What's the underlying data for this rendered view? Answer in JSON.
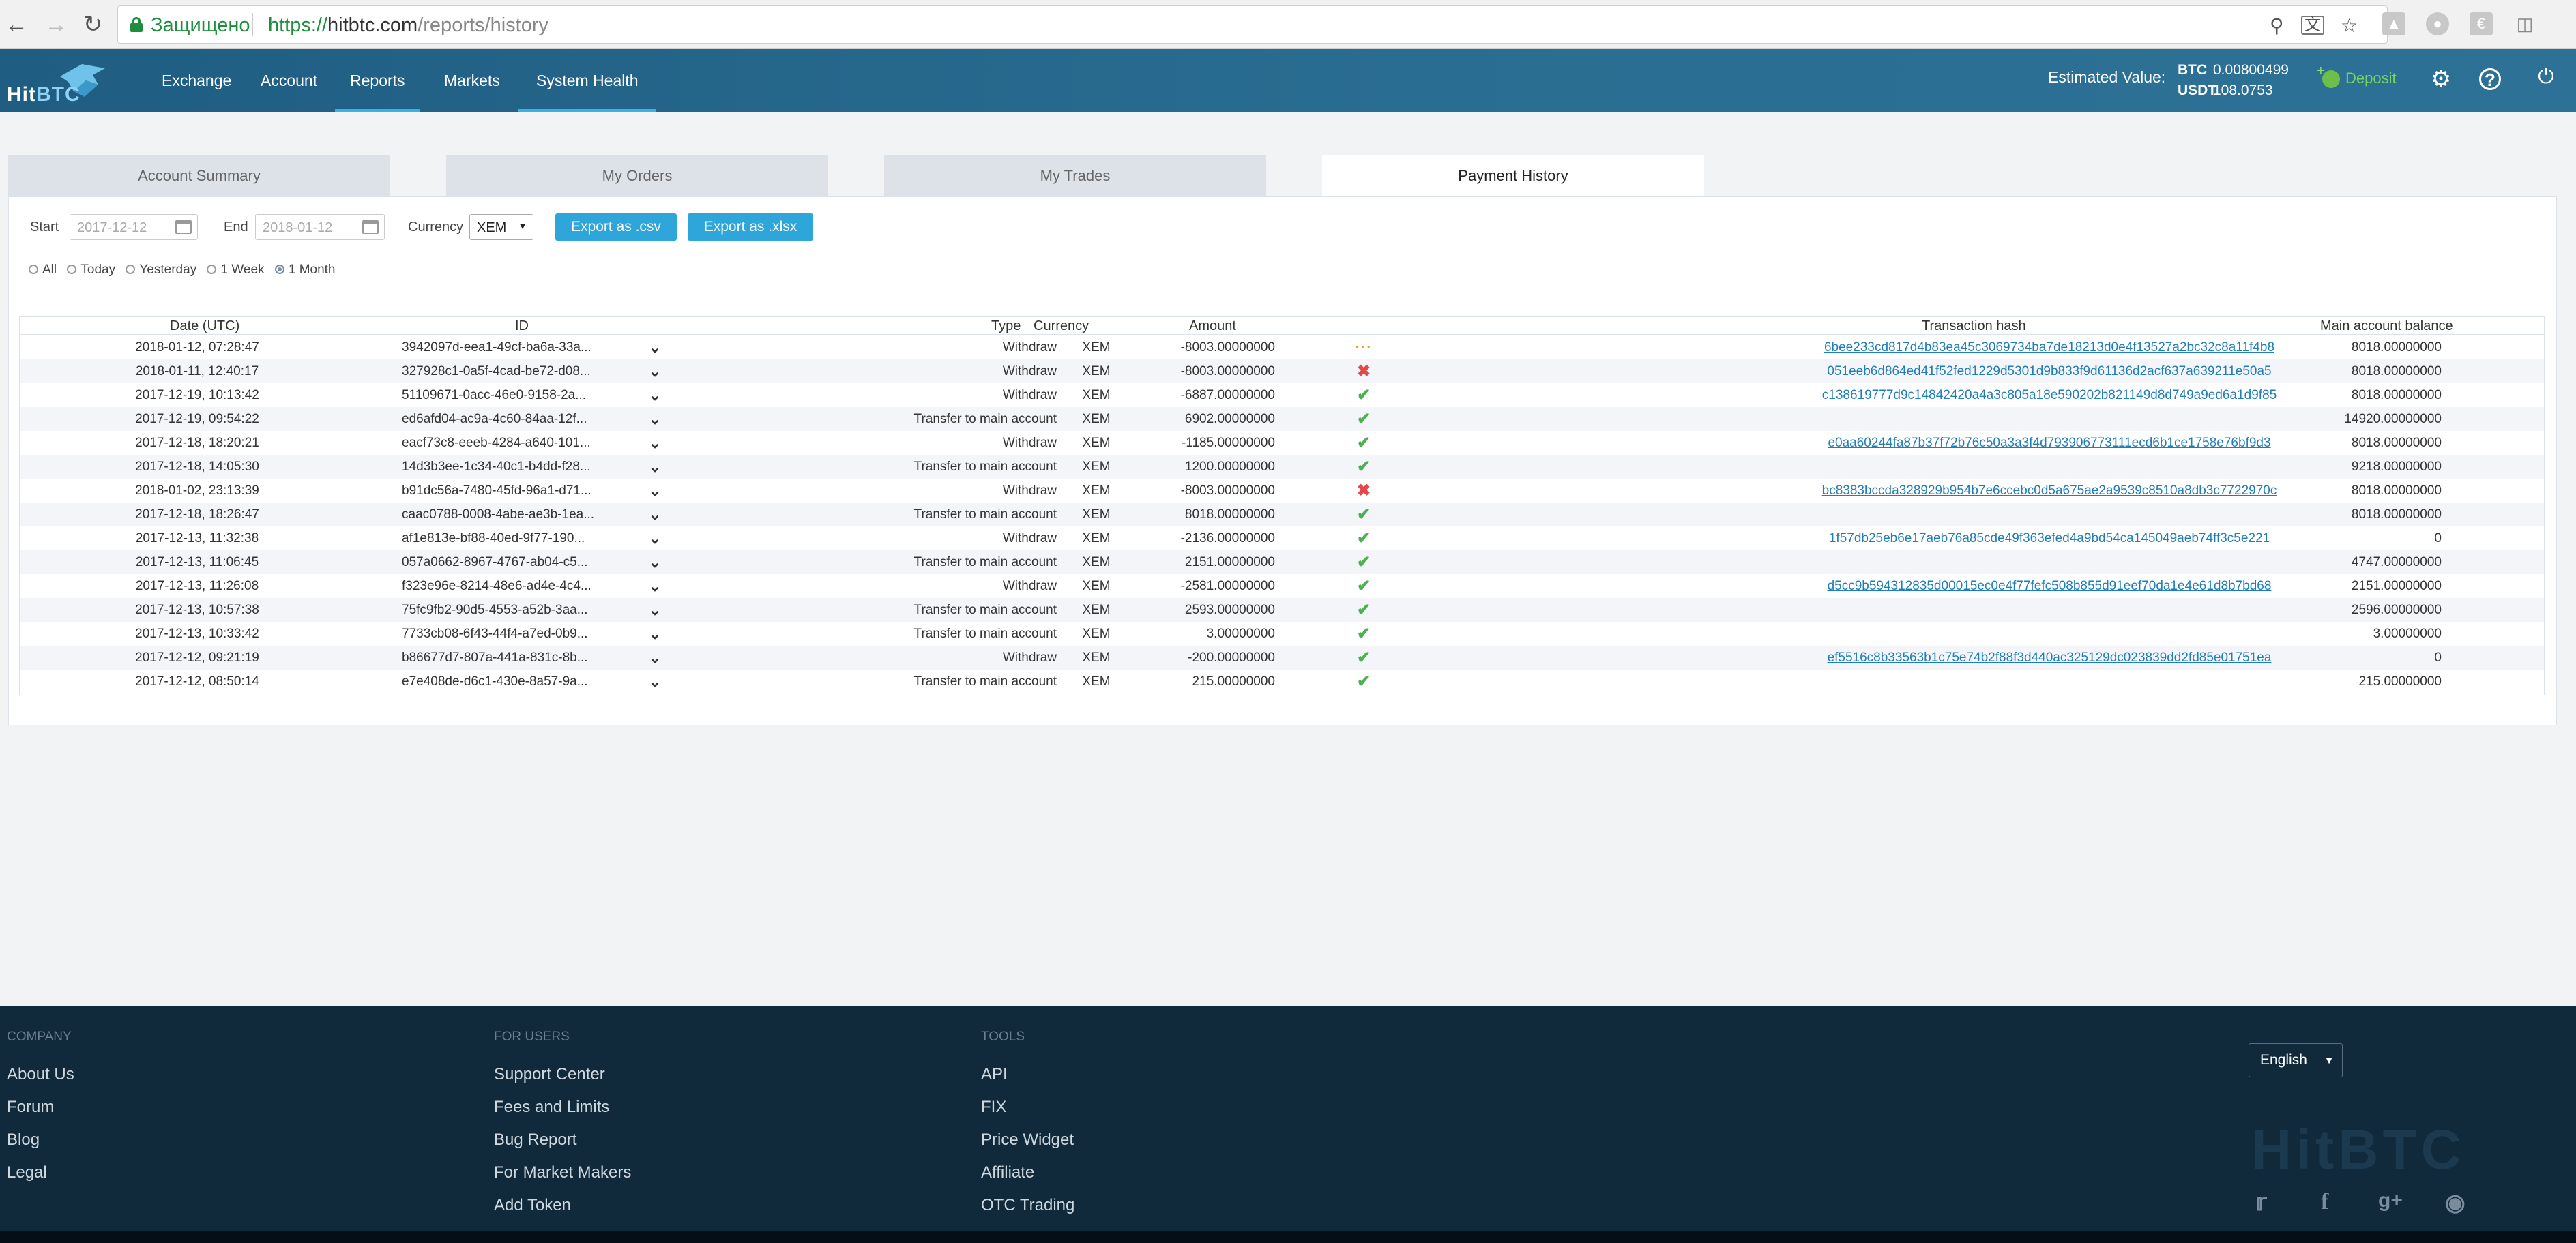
{
  "browser": {
    "secure_label": "Защищено",
    "url_scheme": "https://",
    "url_host": "hitbtc.com",
    "url_path": "/reports/history"
  },
  "header": {
    "logo_hit": "Hit",
    "logo_btc": "BTC",
    "nav": [
      "Exchange",
      "Account",
      "Reports",
      "Markets",
      "System Health"
    ],
    "estimated_label": "Estimated Value:",
    "est_btc_label": "BTC",
    "est_btc_value": "0.00800499",
    "est_usdt_label": "USDT",
    "est_usdt_value": "108.0753",
    "deposit_label": "Deposit"
  },
  "tabs": [
    "Account Summary",
    "My Orders",
    "My Trades",
    "Payment History"
  ],
  "filters": {
    "start_label": "Start",
    "start_value": "2017-12-12",
    "end_label": "End",
    "end_value": "2018-01-12",
    "currency_label": "Currency",
    "currency_value": "XEM",
    "export_csv": "Export as .csv",
    "export_xlsx": "Export as .xlsx",
    "ranges": [
      "All",
      "Today",
      "Yesterday",
      "1 Week",
      "1 Month"
    ],
    "selected_range": "1 Month"
  },
  "table": {
    "headers": [
      "Date (UTC)",
      "ID",
      "Type",
      "Currency",
      "Amount",
      "Transaction hash",
      "Main account balance"
    ],
    "rows": [
      {
        "date": "2018-01-12, 07:28:47",
        "id": "3942097d-eea1-49cf-ba6a-33a...",
        "type": "Withdraw",
        "currency": "XEM",
        "amount": "-8003.00000000",
        "status": "pending",
        "hash": "6bee233cd817d4b83ea45c3069734ba7de18213d0e4f13527a2bc32c8a11f4b8",
        "balance": "8018.00000000"
      },
      {
        "date": "2018-01-11, 12:40:17",
        "id": "327928c1-0a5f-4cad-be72-d08...",
        "type": "Withdraw",
        "currency": "XEM",
        "amount": "-8003.00000000",
        "status": "failed",
        "hash": "051eeb6d864ed41f52fed1229d5301d9b833f9d61136d2acf637a639211e50a5",
        "balance": "8018.00000000"
      },
      {
        "date": "2017-12-19, 10:13:42",
        "id": "51109671-0acc-46e0-9158-2a...",
        "type": "Withdraw",
        "currency": "XEM",
        "amount": "-6887.00000000",
        "status": "success",
        "hash": "c138619777d9c14842420a4a3c805a18e590202b821149d8d749a9ed6a1d9f85",
        "balance": "8018.00000000"
      },
      {
        "date": "2017-12-19, 09:54:22",
        "id": "ed6afd04-ac9a-4c60-84aa-12f...",
        "type": "Transfer to main account",
        "currency": "XEM",
        "amount": "6902.00000000",
        "status": "success",
        "hash": "",
        "balance": "14920.00000000"
      },
      {
        "date": "2017-12-18, 18:20:21",
        "id": "eacf73c8-eeeb-4284-a640-101...",
        "type": "Withdraw",
        "currency": "XEM",
        "amount": "-1185.00000000",
        "status": "success",
        "hash": "e0aa60244fa87b37f72b76c50a3a3f4d793906773111ecd6b1ce1758e76bf9d3",
        "balance": "8018.00000000"
      },
      {
        "date": "2017-12-18, 14:05:30",
        "id": "14d3b3ee-1c34-40c1-b4dd-f28...",
        "type": "Transfer to main account",
        "currency": "XEM",
        "amount": "1200.00000000",
        "status": "success",
        "hash": "",
        "balance": "9218.00000000"
      },
      {
        "date": "2018-01-02, 23:13:39",
        "id": "b91dc56a-7480-45fd-96a1-d71...",
        "type": "Withdraw",
        "currency": "XEM",
        "amount": "-8003.00000000",
        "status": "failed",
        "hash": "bc8383bccda328929b954b7e6ccebc0d5a675ae2a9539c8510a8db3c7722970c",
        "balance": "8018.00000000"
      },
      {
        "date": "2017-12-18, 18:26:47",
        "id": "caac0788-0008-4abe-ae3b-1ea...",
        "type": "Transfer to main account",
        "currency": "XEM",
        "amount": "8018.00000000",
        "status": "success",
        "hash": "",
        "balance": "8018.00000000"
      },
      {
        "date": "2017-12-13, 11:32:38",
        "id": "af1e813e-bf88-40ed-9f77-190...",
        "type": "Withdraw",
        "currency": "XEM",
        "amount": "-2136.00000000",
        "status": "success",
        "hash": "1f57db25eb6e17aeb76a85cde49f363efed4a9bd54ca145049aeb74ff3c5e221",
        "balance": "0"
      },
      {
        "date": "2017-12-13, 11:06:45",
        "id": "057a0662-8967-4767-ab04-c5...",
        "type": "Transfer to main account",
        "currency": "XEM",
        "amount": "2151.00000000",
        "status": "success",
        "hash": "",
        "balance": "4747.00000000"
      },
      {
        "date": "2017-12-13, 11:26:08",
        "id": "f323e96e-8214-48e6-ad4e-4c4...",
        "type": "Withdraw",
        "currency": "XEM",
        "amount": "-2581.00000000",
        "status": "success",
        "hash": "d5cc9b594312835d00015ec0e4f77fefc508b855d91eef70da1e4e61d8b7bd68",
        "balance": "2151.00000000"
      },
      {
        "date": "2017-12-13, 10:57:38",
        "id": "75fc9fb2-90d5-4553-a52b-3aa...",
        "type": "Transfer to main account",
        "currency": "XEM",
        "amount": "2593.00000000",
        "status": "success",
        "hash": "",
        "balance": "2596.00000000"
      },
      {
        "date": "2017-12-13, 10:33:42",
        "id": "7733cb08-6f43-44f4-a7ed-0b9...",
        "type": "Transfer to main account",
        "currency": "XEM",
        "amount": "3.00000000",
        "status": "success",
        "hash": "",
        "balance": "3.00000000"
      },
      {
        "date": "2017-12-12, 09:21:19",
        "id": "b86677d7-807a-441a-831c-8b...",
        "type": "Withdraw",
        "currency": "XEM",
        "amount": "-200.00000000",
        "status": "success",
        "hash": "ef5516c8b33563b1c75e74b2f88f3d440ac325129dc023839dd2fd85e01751ea",
        "balance": "0"
      },
      {
        "date": "2017-12-12, 08:50:14",
        "id": "e7e408de-d6c1-430e-8a57-9a...",
        "type": "Transfer to main account",
        "currency": "XEM",
        "amount": "215.00000000",
        "status": "success",
        "hash": "",
        "balance": "215.00000000"
      }
    ]
  },
  "footer": {
    "columns": [
      {
        "title": "COMPANY",
        "links": [
          "About Us",
          "Forum",
          "Blog",
          "Legal"
        ]
      },
      {
        "title": "FOR USERS",
        "links": [
          "Support Center",
          "Fees and Limits",
          "Bug Report",
          "For Market Makers",
          "Add Token"
        ]
      },
      {
        "title": "TOOLS",
        "links": [
          "API",
          "FIX",
          "Price Widget",
          "Affiliate",
          "OTC Trading"
        ]
      }
    ],
    "language": "English",
    "watermark": "HitBTC"
  }
}
